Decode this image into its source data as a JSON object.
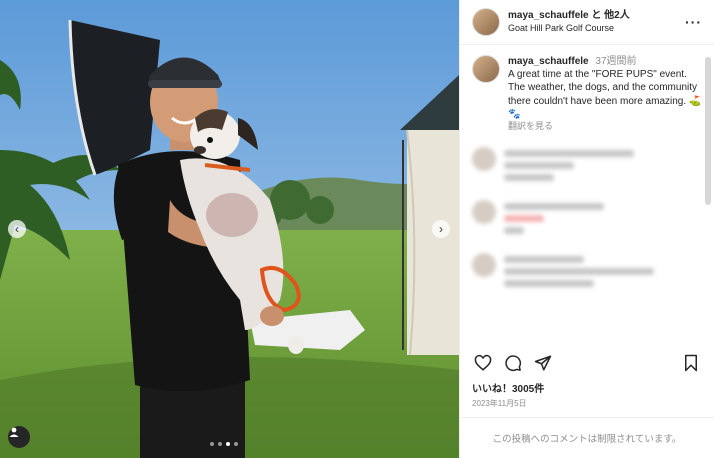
{
  "post": {
    "username": "maya_schauffele",
    "coauthors": "と 他2人",
    "location": "Goat Hill Park Golf Course",
    "caption": {
      "username": "maya_schauffele",
      "time": "37週間前",
      "text": "A great time at the \"FORE PUPS\" event. The weather, the dogs, and the community there couldn't have been more amazing. ⛳ 🐾",
      "translate": "翻訳を見る"
    },
    "likes": "いいね！3005件",
    "date": "2023年11月5日",
    "comments_disabled": "この投稿へのコメントは制限されています。"
  },
  "icons": {
    "more": "more-options-icon",
    "like": "heart-icon",
    "comment": "comment-icon",
    "share": "send-icon",
    "save": "bookmark-icon",
    "prev": "chevron-left-icon",
    "next": "chevron-right-icon",
    "tag": "user-tag-icon"
  },
  "colors": {
    "text": "#262626",
    "muted": "#8e8e8e",
    "border": "#efefef"
  }
}
